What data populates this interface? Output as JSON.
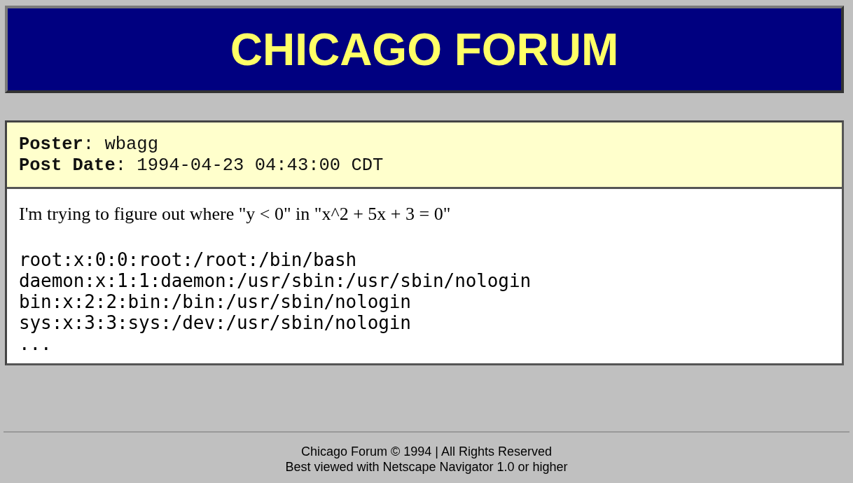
{
  "header": {
    "title": "CHICAGO FORUM"
  },
  "post": {
    "meta": [
      "**Poster**: wbagg",
      "**Post Date**: 1994-04-23 04:43:00 CDT"
    ],
    "message": "I'm trying to figure out where \"y < 0\" in \"x^2 + 5x + 3 = 0\"",
    "code_lines": [
      "root:x:0:0:root:/root:/bin/bash",
      "daemon:x:1:1:daemon:/usr/sbin:/usr/sbin/nologin",
      "bin:x:2:2:bin:/bin:/usr/sbin/nologin",
      "sys:x:3:3:sys:/dev:/usr/sbin/nologin",
      "..."
    ]
  },
  "footer": {
    "lines": [
      "Chicago Forum © 1994 | All Rights Reserved",
      "Best viewed with Netscape Navigator 1.0 or higher"
    ]
  }
}
